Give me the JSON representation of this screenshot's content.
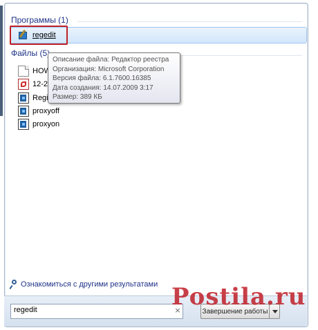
{
  "sections": {
    "programs": {
      "header": "Программы (1)",
      "items": [
        {
          "label": "regedit",
          "icon": "regedit-icon"
        }
      ]
    },
    "files": {
      "header": "Файлы (5)",
      "items": [
        {
          "label": "HOW",
          "icon": "document-icon"
        },
        {
          "label": "12-20",
          "icon": "pdf-icon"
        },
        {
          "label": "Regis",
          "icon": "reg-file-icon"
        },
        {
          "label": "proxyoff",
          "icon": "reg-file-icon"
        },
        {
          "label": "proxyon",
          "icon": "reg-file-icon"
        }
      ]
    }
  },
  "tooltip": {
    "lines": [
      "Описание файла: Редактор реестра",
      "Организация: Microsoft Corporation",
      "Версия файла: 6.1.7600.16385",
      "Дата создания: 14.07.2009 3:17",
      "Размер: 389 КБ"
    ]
  },
  "more_results": "Ознакомиться с другими результатами",
  "search": {
    "value": "regedit"
  },
  "shutdown_label": "Завершение работы",
  "watermark": "Postila.ru",
  "colors": {
    "header": "#1e3287",
    "highlight_border": "#c02027",
    "selection": "#d3e6fb"
  }
}
